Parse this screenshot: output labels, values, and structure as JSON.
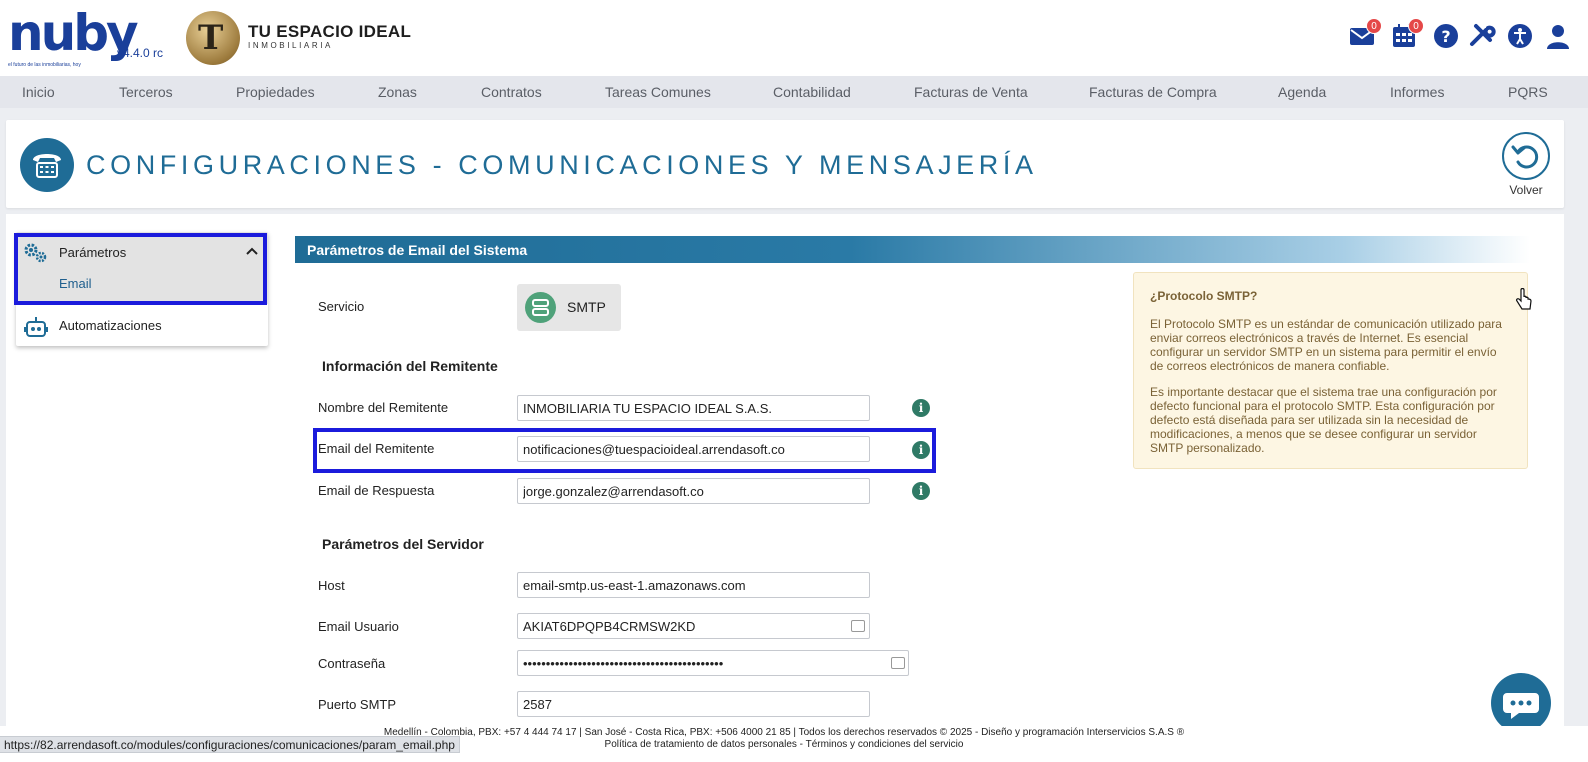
{
  "header": {
    "logo_text": "nuby",
    "logo_tagline": "el futuro de las inmobiliarias, hoy",
    "version": "v4.4.0 rc",
    "brand_name": "TU ESPACIO IDEAL",
    "brand_sub": "INMOBILIARIA",
    "mail_badge": "0",
    "calendar_badge": "0",
    "icons": [
      "envelope-icon",
      "calendar-icon",
      "help-icon",
      "tools-icon",
      "accessibility-icon",
      "user-icon"
    ]
  },
  "nav": {
    "items": [
      "Inicio",
      "Terceros",
      "Propiedades",
      "Zonas",
      "Contratos",
      "Tareas Comunes",
      "Contabilidad",
      "Facturas de Venta",
      "Facturas de Compra",
      "Agenda",
      "Informes",
      "PQRS"
    ]
  },
  "title_panel": {
    "title": "CONFIGURACIONES - COMUNICACIONES Y MENSAJERÍA",
    "back_label": "Volver"
  },
  "side_menu": {
    "group_label": "Parámetros",
    "sub_item": "Email",
    "second_label": "Automatizaciones"
  },
  "form": {
    "section_title": "Parámetros de Email del Sistema",
    "service_label": "Servicio",
    "service_value": "SMTP",
    "sender_title": "Información del Remitente",
    "sender_name_label": "Nombre del Remitente",
    "sender_name_value": "INMOBILIARIA TU ESPACIO IDEAL S.A.S.",
    "sender_email_label": "Email del Remitente",
    "sender_email_value": "notificaciones@tuespacioideal.arrendasoft.co",
    "reply_email_label": "Email de Respuesta",
    "reply_email_value": "jorge.gonzalez@arrendasoft.co",
    "server_title": "Parámetros del Servidor",
    "host_label": "Host",
    "host_value": "email-smtp.us-east-1.amazonaws.com",
    "user_label": "Email Usuario",
    "user_value": "AKIAT6DPQPB4CRMSW2KD",
    "password_label": "Contraseña",
    "password_value": "••••••••••••••••••••••••••••••••••••••••••••",
    "port_label": "Puerto SMTP",
    "port_value": "2587"
  },
  "note": {
    "title": "¿Protocolo SMTP?",
    "p1": "El Protocolo SMTP es un estándar de comunicación utilizado para enviar correos electrónicos a través de Internet. Es esencial configurar un servidor SMTP en un sistema para permitir el envío de correos electrónicos de manera confiable.",
    "p2": "Es importante destacar que el sistema trae una configuración por defecto funcional para el protocolo SMTP. Esta configuración por defecto está diseñada para ser utilizada sin la necesidad de modificaciones, a menos que se desee configurar un servidor SMTP personalizado."
  },
  "footer": {
    "line1": "Medellín - Colombia, PBX: +57 4 444 74 17 | San José - Costa Rica, PBX: +506 4000 21 85 | Todos los derechos reservados © 2025 - Diseño y programación Interservicios S.A.S ®",
    "line2": "Política de tratamiento de datos personales - Términos y condiciones del servicio",
    "status_url": "https://82.arrendasoft.co/modules/configuraciones/comunicaciones/param_email.php"
  },
  "colors": {
    "primary": "#1f6c96",
    "highlight": "#1b1bdc",
    "note_bg": "#fdf6e3",
    "info": "#2f7a66",
    "badge": "#e54848"
  }
}
